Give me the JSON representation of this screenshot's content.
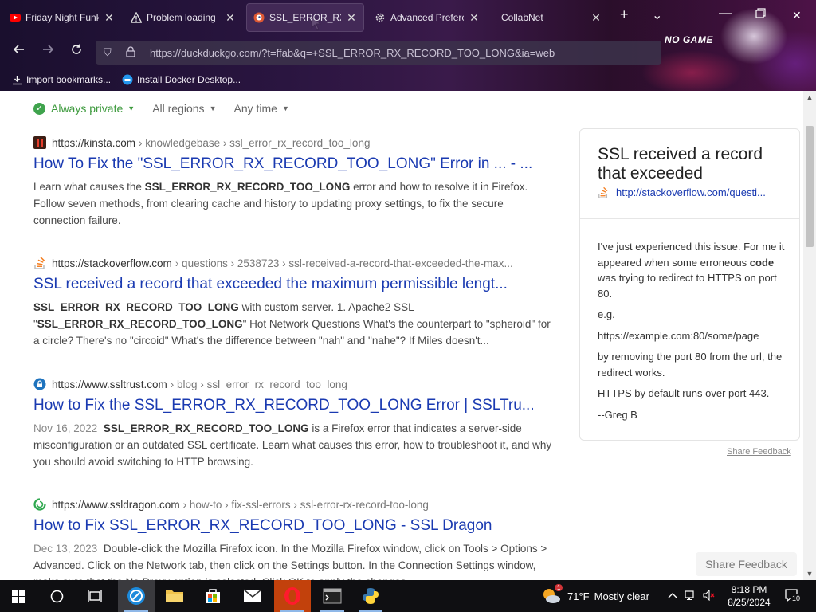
{
  "browser": {
    "tabs": [
      {
        "label": "Friday Night Funk",
        "favicon": "youtube-icon",
        "close": "✕",
        "active": false
      },
      {
        "label": "Problem loading",
        "favicon": "warning-icon",
        "close": "✕",
        "active": false
      },
      {
        "label": "SSL_ERROR_RX_R",
        "favicon": "duckduckgo-icon",
        "close": "✕",
        "active": true
      },
      {
        "label": "Advanced Prefere",
        "favicon": "gear-icon",
        "close": "✕",
        "active": false
      },
      {
        "label": "CollabNet",
        "favicon": "",
        "close": "✕",
        "active": false
      }
    ],
    "new_tab": "+",
    "tab_list": "⌄",
    "theme_art_text": "NO GAME",
    "url": "https://duckduckgo.com/?t=ffab&q=+SSL_ERROR_RX_RECORD_TOO_LONG&ia=web",
    "bookmarks": [
      {
        "label": "Import bookmarks...",
        "icon": "import-icon"
      },
      {
        "label": "Install Docker Desktop...",
        "icon": "docker-icon"
      }
    ]
  },
  "filters": {
    "privacy": "Always private",
    "region": "All regions",
    "time": "Any time"
  },
  "results": [
    {
      "domain": "https://kinsta.com",
      "path": "› knowledgebase › ssl_error_rx_record_too_long",
      "favicon_color": "#e53c2b",
      "title": "How To Fix the \"SSL_ERROR_RX_RECORD_TOO_LONG\" Error in ... - ...",
      "date": "",
      "snippet_html": "Learn what causes the <b>SSL_ERROR_RX_RECORD_TOO_LONG</b> error and how to resolve it in Firefox. Follow seven methods, from clearing cache and history to updating proxy settings, to fix the secure connection failure."
    },
    {
      "domain": "https://stackoverflow.com",
      "path": "› questions › 2538723 › ssl-received-a-record-that-exceeded-the-max...",
      "favicon_color": "#f48024",
      "title": "SSL received a record that exceeded the maximum permissible lengt...",
      "date": "",
      "snippet_html": "<b>SSL_ERROR_RX_RECORD_TOO_LONG</b> with custom server. 1. Apache2 SSL \"<b>SSL_ERROR_RX_RECORD_TOO_LONG</b>\" Hot Network Questions What's the counterpart to \"spheroid\" for a circle? There's no \"circoid\" What's the difference between \"nah\" and \"nahe\"? If Miles doesn't..."
    },
    {
      "domain": "https://www.ssltrust.com",
      "path": "› blog › ssl_error_rx_record_too_long",
      "favicon_color": "#1e73be",
      "title": "How to Fix the SSL_ERROR_RX_RECORD_TOO_LONG Error | SSLTru...",
      "date": "Nov 16, 2022",
      "snippet_html": "<b>SSL_ERROR_RX_RECORD_TOO_LONG</b> is a Firefox error that indicates a server-side misconfiguration or an outdated SSL certificate. Learn what causes this error, how to troubleshoot it, and why you should avoid switching to HTTP browsing."
    },
    {
      "domain": "https://www.ssldragon.com",
      "path": "› how-to › fix-ssl-errors › ssl-error-rx-record-too-long",
      "favicon_color": "#2fa84f",
      "title": "How to Fix SSL_ERROR_RX_RECORD_TOO_LONG - SSL Dragon",
      "date": "Dec 13, 2023",
      "snippet_html": "Double-click the Mozilla Firefox icon. In the Mozilla Firefox window, click on Tools > Options > Advanced. Click on the Network tab, then click on the Settings button. In the Connection Settings window, make sure that the No Proxy option is selected. Click OK to apply the changes."
    }
  ],
  "infobox": {
    "title": "SSL received a record that exceeded",
    "link": "http://stackoverflow.com/questi...",
    "paragraphs_html": [
      "I've just experienced this issue. For me it appeared when some erroneous <b>code</b> was trying to redirect to HTTPS on port 80.",
      "e.g.",
      "https://example.com:80/some/page",
      "by removing the port 80 from the url, the redirect works.",
      "HTTPS by default runs over port 443.",
      "--Greg B"
    ],
    "share_link": "Share Feedback"
  },
  "share_button": "Share Feedback",
  "taskbar": {
    "weather": {
      "temp": "71°F",
      "condition": "Mostly clear",
      "badge": "1"
    },
    "time": "8:18 PM",
    "date": "8/25/2024",
    "notifications": "10"
  }
}
